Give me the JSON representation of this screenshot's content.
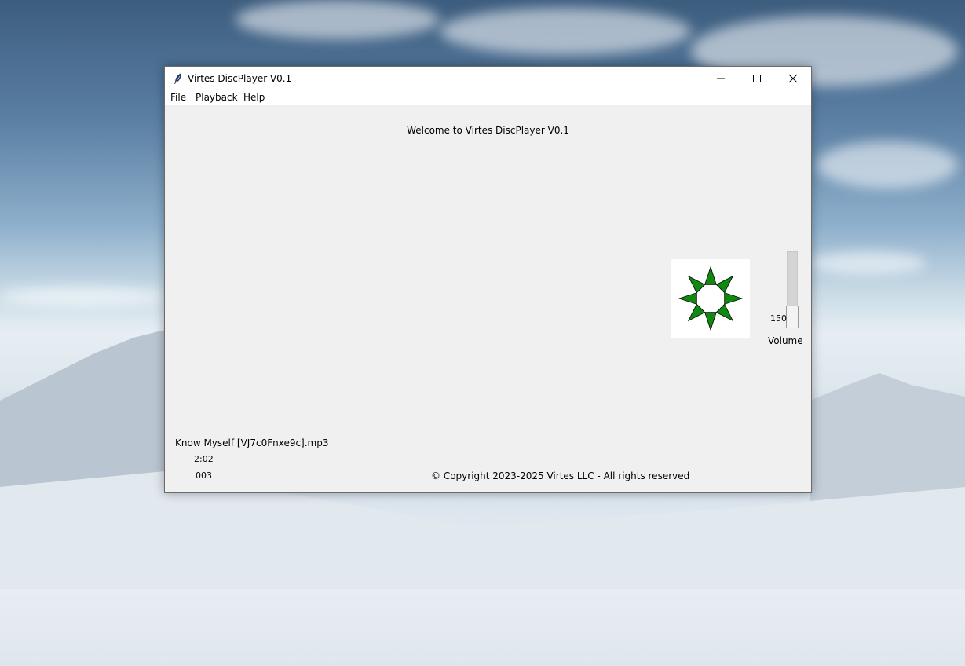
{
  "window": {
    "title": "Virtes DiscPlayer V0.1",
    "controls": {
      "minimize_icon": "minimize-icon",
      "maximize_icon": "maximize-icon",
      "close_icon": "close-icon"
    }
  },
  "menu": {
    "items": [
      {
        "label": "File"
      },
      {
        "label": "Playback"
      },
      {
        "label": "Help"
      }
    ]
  },
  "main": {
    "welcome": "Welcome to Virtes DiscPlayer V0.1",
    "disc_icon": "spinning-disc-star-icon",
    "disc_color": "#0f8a0f",
    "volume": {
      "value": "150",
      "label": "Volume"
    }
  },
  "track": {
    "name": "Know Myself [VJ7c0Fnxe9c].mp3",
    "time": "2:02",
    "number": "003"
  },
  "footer": {
    "copyright": "© Copyright 2023-2025 Virtes LLC - All rights reserved"
  }
}
